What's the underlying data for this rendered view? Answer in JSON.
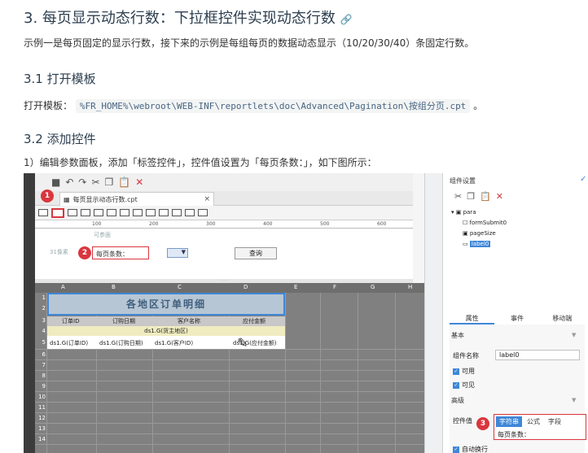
{
  "doc": {
    "title": "3. 每页显示动态行数：下拉框控件实现动态行数",
    "link_icon": "🔗",
    "intro": "示例一是每页固定的显示行数，接下来的示例是每组每页的数据动态显示（10/20/30/40）条固定行数。",
    "sec31": "3.1 打开模板",
    "open_label": "打开模板：",
    "open_path": "%FR_HOME%\\webroot\\WEB-INF\\reportlets\\doc\\Advanced\\Pagination\\按组分页.cpt",
    "open_suffix": "。",
    "sec32": "3.2 添加控件",
    "step1": "1）编辑参数面板，添加「标签控件」，控件值设置为「每页条数：」，如下图所示："
  },
  "shot": {
    "tab_label": "每页显示动态行数.cpt",
    "tab_close": "×",
    "ruler": [
      "100",
      "200",
      "300",
      "400",
      "500",
      "600"
    ],
    "param_hint1": "可参面",
    "param_hint2": "31像素",
    "label_text": "每页条数：",
    "combo_arrow": "▼",
    "query_label": "查询",
    "col_headers": [
      "A",
      "B",
      "C",
      "D",
      "E",
      "F",
      "G",
      "H"
    ],
    "row_nums": [
      "1",
      "2",
      "3",
      "4",
      "5",
      "6",
      "7",
      "8",
      "9",
      "10",
      "11",
      "12",
      "13",
      "14"
    ],
    "report_title": "各地区订单明细",
    "headers": [
      "订单ID",
      "订购日期",
      "客户名称",
      "应付金额"
    ],
    "group_row": "ds1.G(货主地区)",
    "data_cells": [
      "ds1.G(订单ID)",
      "ds1.G(订购日期)",
      "ds1.G(客户ID)",
      "ds1.G(应付金额)"
    ],
    "badges": [
      "1",
      "2",
      "3"
    ]
  },
  "panel": {
    "title": "组件设置",
    "tree": [
      "para",
      "formSubmit0",
      "pageSize",
      "label0"
    ],
    "tabs": [
      "属性",
      "事件",
      "移动端"
    ],
    "sec_basic": "基本",
    "name_label": "组件名称",
    "name_value": "label0",
    "chk_enabled": "可用",
    "chk_visible": "可见",
    "sec_advanced": "高级",
    "value_label": "控件值",
    "value_tabs": [
      "字符串",
      "公式",
      "字段"
    ],
    "value_text": "每页条数：",
    "chk_wrap": "自动换行"
  }
}
